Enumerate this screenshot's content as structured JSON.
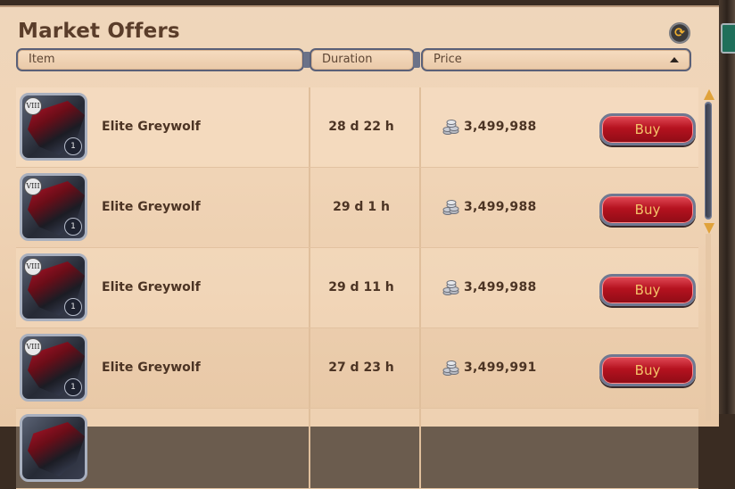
{
  "window": {
    "title": "Market Offers",
    "refresh_icon": "refresh-icon"
  },
  "table": {
    "headers": {
      "item": "Item",
      "duration": "Duration",
      "price": "Price"
    },
    "sort": {
      "column": "price",
      "direction": "ascending"
    },
    "rows": [
      {
        "tier": "VIII",
        "enchant": "1",
        "name": "Elite Greywolf",
        "duration": "28 d 22 h",
        "price": "3,499,988",
        "action": "Buy"
      },
      {
        "tier": "VIII",
        "enchant": "1",
        "name": "Elite Greywolf",
        "duration": "29 d 1 h",
        "price": "3,499,988",
        "action": "Buy"
      },
      {
        "tier": "VIII",
        "enchant": "1",
        "name": "Elite Greywolf",
        "duration": "29 d 11 h",
        "price": "3,499,988",
        "action": "Buy"
      },
      {
        "tier": "VIII",
        "enchant": "1",
        "name": "Elite Greywolf",
        "duration": "27 d 23 h",
        "price": "3,499,991",
        "action": "Buy"
      }
    ]
  },
  "colors": {
    "panel_bg": "#efd6bb",
    "text": "#4c3424",
    "buy_button": "#b5121f",
    "buy_label": "#f3c46a",
    "header_border": "#5a6078"
  }
}
